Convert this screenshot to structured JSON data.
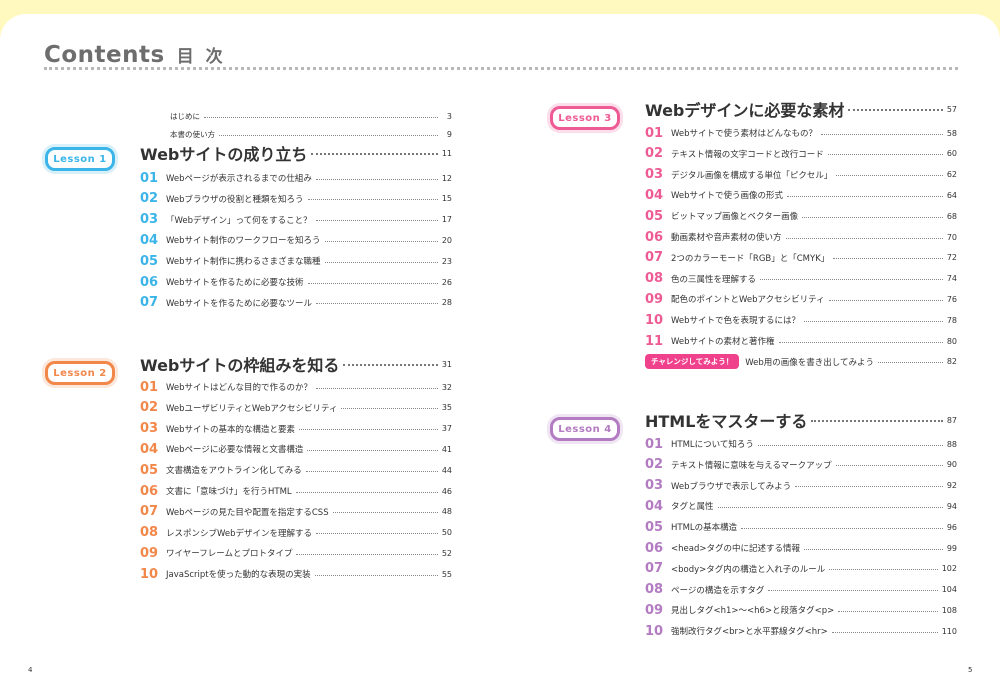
{
  "title": {
    "en": "Contents",
    "jp": "目 次"
  },
  "intro": [
    {
      "label": "はじめに",
      "page": "3"
    },
    {
      "label": "本書の使い方",
      "page": "9"
    }
  ],
  "lessons": [
    {
      "badge": "Lesson 1",
      "color": "#3bb5e8",
      "title": "Webサイトの成り立ち",
      "page": "11",
      "items": [
        {
          "num": "01",
          "label": "Webページが表示されるまでの仕組み",
          "page": "12"
        },
        {
          "num": "02",
          "label": "Webブラウザの役割と種類を知ろう",
          "page": "15"
        },
        {
          "num": "03",
          "label": "「Webデザイン」って何をすること？",
          "page": "17"
        },
        {
          "num": "04",
          "label": "Webサイト制作のワークフローを知ろう",
          "page": "20"
        },
        {
          "num": "05",
          "label": "Webサイト制作に携わるさまざまな職種",
          "page": "23"
        },
        {
          "num": "06",
          "label": "Webサイトを作るために必要な技術",
          "page": "26"
        },
        {
          "num": "07",
          "label": "Webサイトを作るために必要なツール",
          "page": "28"
        }
      ]
    },
    {
      "badge": "Lesson 2",
      "color": "#f2874a",
      "title": "Webサイトの枠組みを知る",
      "page": "31",
      "items": [
        {
          "num": "01",
          "label": "Webサイトはどんな目的で作るのか？",
          "page": "32"
        },
        {
          "num": "02",
          "label": "WebユーザビリティとWebアクセシビリティ",
          "page": "35"
        },
        {
          "num": "03",
          "label": "Webサイトの基本的な構造と要素",
          "page": "37"
        },
        {
          "num": "04",
          "label": "Webページに必要な情報と文書構造",
          "page": "41"
        },
        {
          "num": "05",
          "label": "文書構造をアウトライン化してみる",
          "page": "44"
        },
        {
          "num": "06",
          "label": "文書に「意味づけ」を行うHTML",
          "page": "46"
        },
        {
          "num": "07",
          "label": "Webページの見た目や配置を指定するCSS",
          "page": "48"
        },
        {
          "num": "08",
          "label": "レスポンシブWebデザインを理解する",
          "page": "50"
        },
        {
          "num": "09",
          "label": "ワイヤーフレームとプロトタイプ",
          "page": "52"
        },
        {
          "num": "10",
          "label": "JavaScriptを使った動的な表現の実装",
          "page": "55"
        }
      ]
    },
    {
      "badge": "Lesson 3",
      "color": "#ee5b94",
      "title": "Webデザインに必要な素材",
      "page": "57",
      "items": [
        {
          "num": "01",
          "label": "Webサイトで使う素材はどんなもの？",
          "page": "58"
        },
        {
          "num": "02",
          "label": "テキスト情報の文字コードと改行コード",
          "page": "60"
        },
        {
          "num": "03",
          "label": "デジタル画像を構成する単位「ピクセル」",
          "page": "62"
        },
        {
          "num": "04",
          "label": "Webサイトで使う画像の形式",
          "page": "64"
        },
        {
          "num": "05",
          "label": "ビットマップ画像とベクター画像",
          "page": "68"
        },
        {
          "num": "06",
          "label": "動画素材や音声素材の使い方",
          "page": "70"
        },
        {
          "num": "07",
          "label": "2つのカラーモード「RGB」と「CMYK」",
          "page": "72"
        },
        {
          "num": "08",
          "label": "色の三属性を理解する",
          "page": "74"
        },
        {
          "num": "09",
          "label": "配色のポイントとWebアクセシビリティ",
          "page": "76"
        },
        {
          "num": "10",
          "label": "Webサイトで色を表現するには？",
          "page": "78"
        },
        {
          "num": "11",
          "label": "Webサイトの素材と著作権",
          "page": "80"
        }
      ],
      "challenge": {
        "tag": "チャレンジしてみよう！",
        "label": "Web用の画像を書き出してみよう",
        "page": "82"
      }
    },
    {
      "badge": "Lesson 4",
      "color": "#b37bc1",
      "title": "HTMLをマスターする",
      "page": "87",
      "items": [
        {
          "num": "01",
          "label": "HTMLについて知ろう",
          "page": "88"
        },
        {
          "num": "02",
          "label": "テキスト情報に意味を与えるマークアップ",
          "page": "90"
        },
        {
          "num": "03",
          "label": "Webブラウザで表示してみよう",
          "page": "92"
        },
        {
          "num": "04",
          "label": "タグと属性",
          "page": "94"
        },
        {
          "num": "05",
          "label": "HTMLの基本構造",
          "page": "96"
        },
        {
          "num": "06",
          "label": "<head>タグの中に記述する情報",
          "page": "99"
        },
        {
          "num": "07",
          "label": "<body>タグ内の構造と入れ子のルール",
          "page": "102"
        },
        {
          "num": "08",
          "label": "ページの構造を示すタグ",
          "page": "104"
        },
        {
          "num": "09",
          "label": "見出しタグ<h1>〜<h6>と段落タグ<p>",
          "page": "108"
        },
        {
          "num": "10",
          "label": "強制改行タグ<br>と水平罫線タグ<hr>",
          "page": "110"
        }
      ]
    }
  ],
  "folios": {
    "left": "4",
    "right": "5"
  }
}
